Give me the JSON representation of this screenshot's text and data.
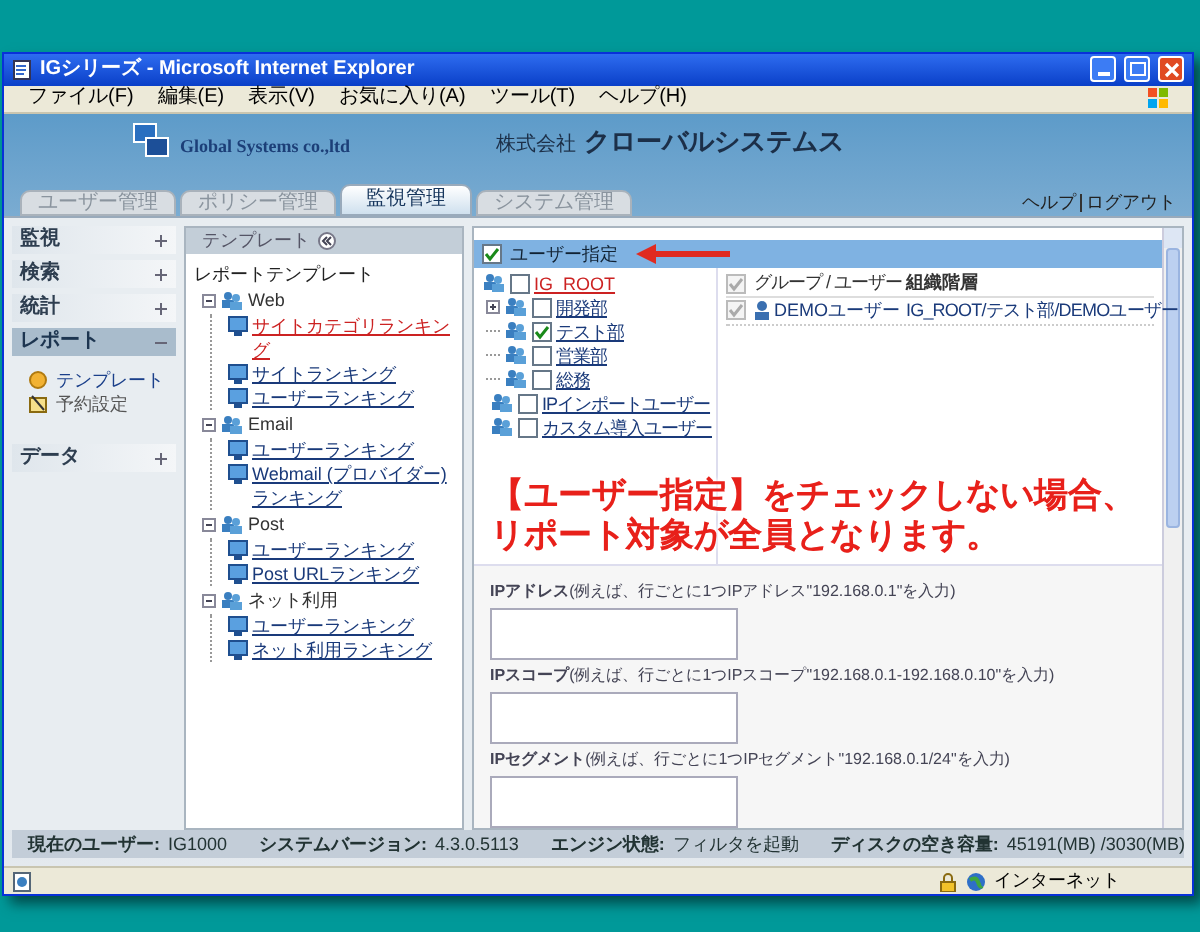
{
  "window": {
    "title": "IGシリーズ - Microsoft Internet Explorer"
  },
  "menu": [
    "ファイル(F)",
    "編集(E)",
    "表示(V)",
    "お気に入り(A)",
    "ツール(T)",
    "ヘルプ(H)"
  ],
  "header": {
    "company_en": "Global Systems co.,ltd",
    "company_prefix": "株式会社",
    "company_name": "クローバルシステムス"
  },
  "tabs": [
    {
      "label": "ユーザー管理",
      "selected": false
    },
    {
      "label": "ポリシー管理",
      "selected": false
    },
    {
      "label": "監視管理",
      "selected": true
    },
    {
      "label": "システム管理",
      "selected": false
    }
  ],
  "header_links": [
    "ヘルプ",
    "ログアウト"
  ],
  "sidebar": {
    "items": [
      {
        "label": "監視",
        "expanded": false,
        "selected": false
      },
      {
        "label": "検索",
        "expanded": false,
        "selected": false
      },
      {
        "label": "統計",
        "expanded": false,
        "selected": false
      },
      {
        "label": "レポート",
        "expanded": true,
        "selected": true,
        "children": [
          {
            "label": "テンプレート",
            "kind": "template"
          },
          {
            "label": "予約設定",
            "kind": "schedule"
          }
        ]
      },
      {
        "label": "データ",
        "expanded": false,
        "selected": false
      }
    ]
  },
  "template_panel": {
    "title": "テンプレート",
    "root": "レポートテンプレート",
    "groups": [
      {
        "label": "Web",
        "children": [
          {
            "label": "サイトカテゴリランキング",
            "selected": true
          },
          {
            "label": "サイトランキング",
            "selected": false
          },
          {
            "label": "ユーザーランキング",
            "selected": false
          }
        ]
      },
      {
        "label": "Email",
        "children": [
          {
            "label": "ユーザーランキング",
            "selected": false
          },
          {
            "label": "Webmail (プロバイダー) ランキング",
            "selected": false
          }
        ]
      },
      {
        "label": "Post",
        "children": [
          {
            "label": "ユーザーランキング",
            "selected": false
          },
          {
            "label": "Post URLランキング",
            "selected": false
          }
        ]
      },
      {
        "label": "ネット利用",
        "children": [
          {
            "label": "ユーザーランキング",
            "selected": false
          },
          {
            "label": "ネット利用ランキング",
            "selected": false
          }
        ]
      }
    ]
  },
  "user_panel": {
    "title": "ユーザー指定",
    "checked": true,
    "tree": {
      "label": "IG_ROOT",
      "selected": true,
      "checked": false,
      "children": [
        {
          "label": "開発部",
          "checked": false,
          "expandable": true
        },
        {
          "label": "テスト部",
          "checked": true,
          "expandable": false
        },
        {
          "label": "営業部",
          "checked": false,
          "expandable": false
        },
        {
          "label": "総務",
          "checked": false,
          "expandable": false
        },
        {
          "label": "IPインポートユーザー",
          "checked": false,
          "expandable": false
        },
        {
          "label": "カスタム導入ユーザー",
          "checked": false,
          "expandable": false
        }
      ]
    },
    "table": {
      "header_checked": true,
      "columns": [
        "グループ / ユーザー",
        "組織階層"
      ],
      "rows": [
        {
          "checked": true,
          "name": "DEMOユーザー",
          "path": "IG_ROOT/テスト部/DEMOユーザー"
        }
      ]
    }
  },
  "fields": [
    {
      "label": "**IPアドレス**(例えば、行ごとに1つIPアドレス\"192.168.0.1\"を入力)"
    },
    {
      "label": "**IPスコープ**(例えば、行ごとに1つIPスコープ\"192.168.0.1-192.168.0.10\"を入力)"
    },
    {
      "label": "**IPセグメント**(例えば、行ごとに1つIPセグメント\"192.168.0.1/24\"を入力)"
    }
  ],
  "annotation": [
    "【ユーザー指定】をチェックしない場合、",
    "リポート対象が全員となります。"
  ],
  "status": [
    {
      "label": "現在のユーザー:",
      "value": "IG1000"
    },
    {
      "label": "システムバージョン:",
      "value": "4.3.0.5113"
    },
    {
      "label": "エンジン状態:",
      "value": "フィルタを起動"
    },
    {
      "label": "ディスクの空き容量:",
      "value": "45191(MB) /3030(MB)"
    }
  ],
  "ie_status": {
    "zone": "インターネット"
  }
}
